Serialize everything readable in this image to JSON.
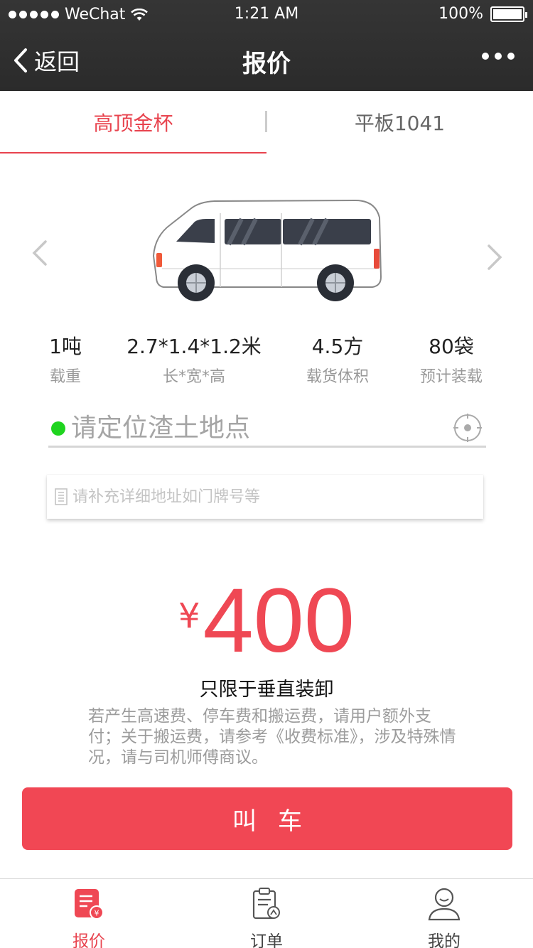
{
  "status_bar": {
    "carrier": "WeChat",
    "time": "1:21 AM",
    "battery": "100%"
  },
  "nav": {
    "back_label": "返回",
    "title": "报价"
  },
  "tabs": [
    {
      "label": "高顶金杯",
      "active": true
    },
    {
      "label": "平板1041",
      "active": false
    }
  ],
  "specs": [
    {
      "value": "1吨",
      "label": "载重"
    },
    {
      "value": "2.7*1.4*1.2米",
      "label": "长*宽*高"
    },
    {
      "value": "4.5方",
      "label": "载货体积"
    },
    {
      "value": "80袋",
      "label": "预计装载"
    }
  ],
  "location": {
    "placeholder": "请定位渣土地点",
    "detail_placeholder": "请补充详细地址如门牌号等"
  },
  "price": {
    "currency": "¥",
    "amount": "400",
    "limit": "只限于垂直装卸",
    "note": "若产生高速费、停车费和搬运费，请用户额外支付；关于搬运费，请参考《收费标准》，涉及特殊情况，请与司机师傅商议。"
  },
  "call_button": "叫车",
  "tabbar": [
    {
      "label": "报价",
      "icon": "quote-icon",
      "active": true
    },
    {
      "label": "订单",
      "icon": "orders-icon",
      "active": false
    },
    {
      "label": "我的",
      "icon": "profile-icon",
      "active": false
    }
  ],
  "colors": {
    "accent": "#e8434e",
    "button": "#f14754",
    "header": "#2f2f2f",
    "location_dot": "#1fd41f"
  }
}
